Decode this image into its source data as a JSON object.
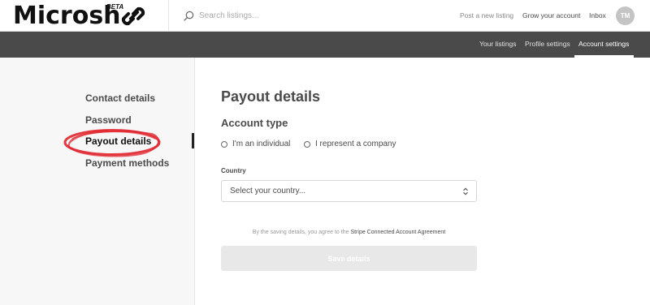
{
  "topbar": {
    "logo_text": "Microsh",
    "logo_badge": "BETA",
    "search": {
      "placeholder": "Search listings..."
    },
    "links": [
      "Post a new listing",
      "Grow your account",
      "Inbox"
    ],
    "avatar_initials": "TM"
  },
  "subnav": {
    "items": [
      "Your listings",
      "Profile settings",
      "Account settings"
    ],
    "active": "Account settings"
  },
  "sidebar": {
    "items": [
      "Contact details",
      "Password",
      "Payout details",
      "Payment methods"
    ],
    "active": "Payout details",
    "annotation_color": "#e0242c"
  },
  "main": {
    "title": "Payout details",
    "account_type": {
      "heading": "Account type",
      "options": [
        "I'm an individual",
        "I represent a company"
      ]
    },
    "country": {
      "label": "Country",
      "value": "Select your country..."
    },
    "agreement": {
      "text": "By the saving details, you agree to the",
      "link": "Stripe Connected Account Agreement"
    },
    "save_label": "Save details"
  },
  "colors": {
    "subnav_bg": "#4a4a4a",
    "sidebar_bg": "#f7f7f7",
    "button_disabled": "#e8e8e8",
    "text": "#4a4a4a"
  }
}
